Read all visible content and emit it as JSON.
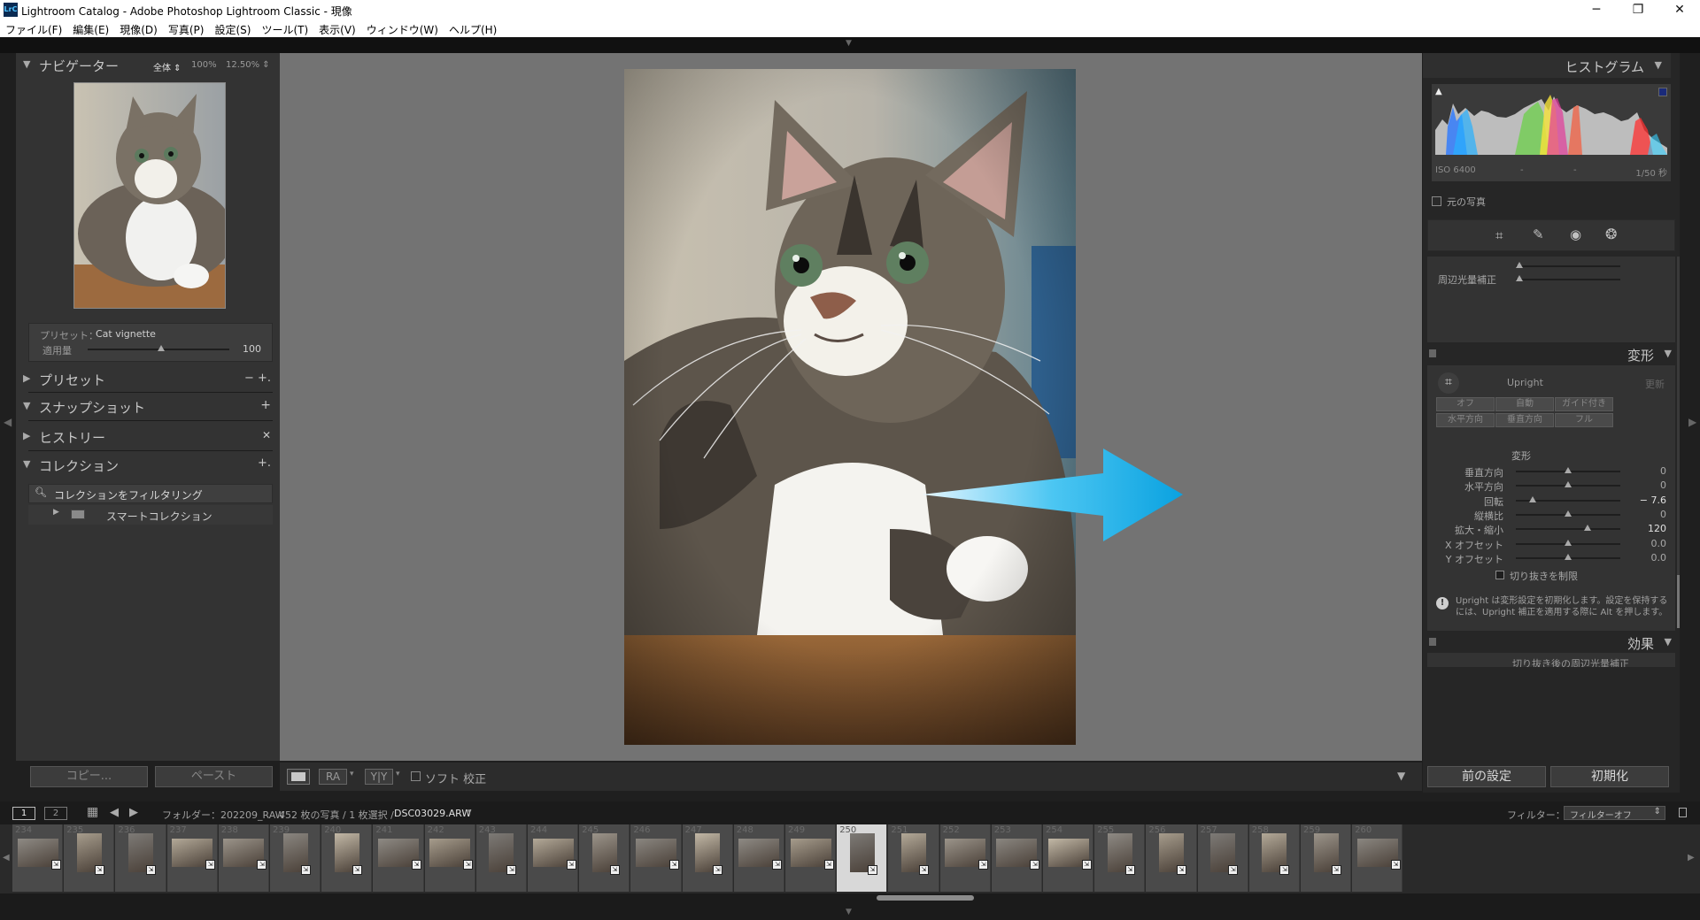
{
  "window": {
    "title": "Lightroom Catalog - Adobe Photoshop Lightroom Classic - 現像",
    "app_icon": "LrC",
    "controls": [
      "─",
      "❐",
      "✕"
    ]
  },
  "menu": [
    "ファイル(F)",
    "編集(E)",
    "現像(D)",
    "写真(P)",
    "設定(S)",
    "ツール(T)",
    "表示(V)",
    "ウィンドウ(W)",
    "ヘルプ(H)"
  ],
  "left": {
    "navigator": {
      "title": "ナビゲーター",
      "fit": "全体 ⇕",
      "zoom1": "100%",
      "zoom2": "12.50% ⇕"
    },
    "preset_amount": {
      "preset_label": "プリセット：",
      "preset_value": "Cat vignette",
      "amount_label": "適用量",
      "amount_value": "100",
      "amount_fraction": 0.52
    },
    "panels": [
      {
        "label": "プリセット",
        "arrow": "▶",
        "action": "− +."
      },
      {
        "label": "スナップショット",
        "arrow": "▼",
        "action": "+"
      },
      {
        "label": "ヒストリー",
        "arrow": "▶",
        "action": "✕"
      },
      {
        "label": "コレクション",
        "arrow": "▼",
        "action": "+."
      }
    ],
    "collection_filter": "コレクションをフィルタリング",
    "smart_collection": "スマートコレクション",
    "copy_button": "コピー...",
    "paste_button": "ペースト"
  },
  "toolbar": {
    "view_ra": "RA",
    "view_yy": "Y|Y",
    "soft_proof": "ソフト 校正"
  },
  "right": {
    "histogram": {
      "title": "ヒストグラム",
      "iso": "ISO 6400",
      "dash1": "-",
      "dash2": "-",
      "shutter": "1/50 秒",
      "original_label": "元の写真"
    },
    "vignette_row": "周辺光量補正",
    "transform": {
      "title": "変形",
      "upright_label": "Upright",
      "update_label": "更新",
      "buttons_row1": [
        "オフ",
        "自動",
        "ガイド付き"
      ],
      "buttons_row2": [
        "水平方向",
        "垂直方向",
        "フル"
      ],
      "subtitle": "変形",
      "sliders": [
        {
          "label": "垂直方向",
          "value": "0",
          "fraction": 0.5
        },
        {
          "label": "水平方向",
          "value": "0",
          "fraction": 0.5
        },
        {
          "label": "回転",
          "value": "− 7.6",
          "fraction": 0.16
        },
        {
          "label": "縦横比",
          "value": "0",
          "fraction": 0.5
        },
        {
          "label": "拡大・縮小",
          "value": "120",
          "fraction": 0.69
        },
        {
          "label": "X オフセット",
          "value": "0.0",
          "fraction": 0.5
        },
        {
          "label": "Y オフセット",
          "value": "0.0",
          "fraction": 0.5
        }
      ],
      "constrain_crop": "切り抜きを制限",
      "note": "Upright は変形設定を初期化します。設定を保持するには、Upright 補正を適用する際に Alt を押します。"
    },
    "effects": {
      "title": "効果",
      "sub": "切り抜き後の周辺光量補正"
    },
    "prev_button": "前の設定",
    "reset_button": "初期化"
  },
  "filmbar": {
    "screen1": "1",
    "screen2": "2",
    "source": "フォルダー：202209_RAW",
    "count": "452 枚の写真 / 1 枚選択 /",
    "filename": "DSC03029.ARW",
    "filter_label": "フィルター：",
    "filter_value": "フィルターオフ"
  },
  "filmstrip": {
    "numbers": [
      "234",
      "235",
      "236",
      "237",
      "238",
      "239",
      "240",
      "241",
      "242",
      "243",
      "244",
      "245",
      "246",
      "247",
      "248",
      "249",
      "250",
      "251",
      "252",
      "253",
      "254",
      "255",
      "256",
      "257",
      "258",
      "259",
      "260"
    ],
    "selected_index": 16
  }
}
